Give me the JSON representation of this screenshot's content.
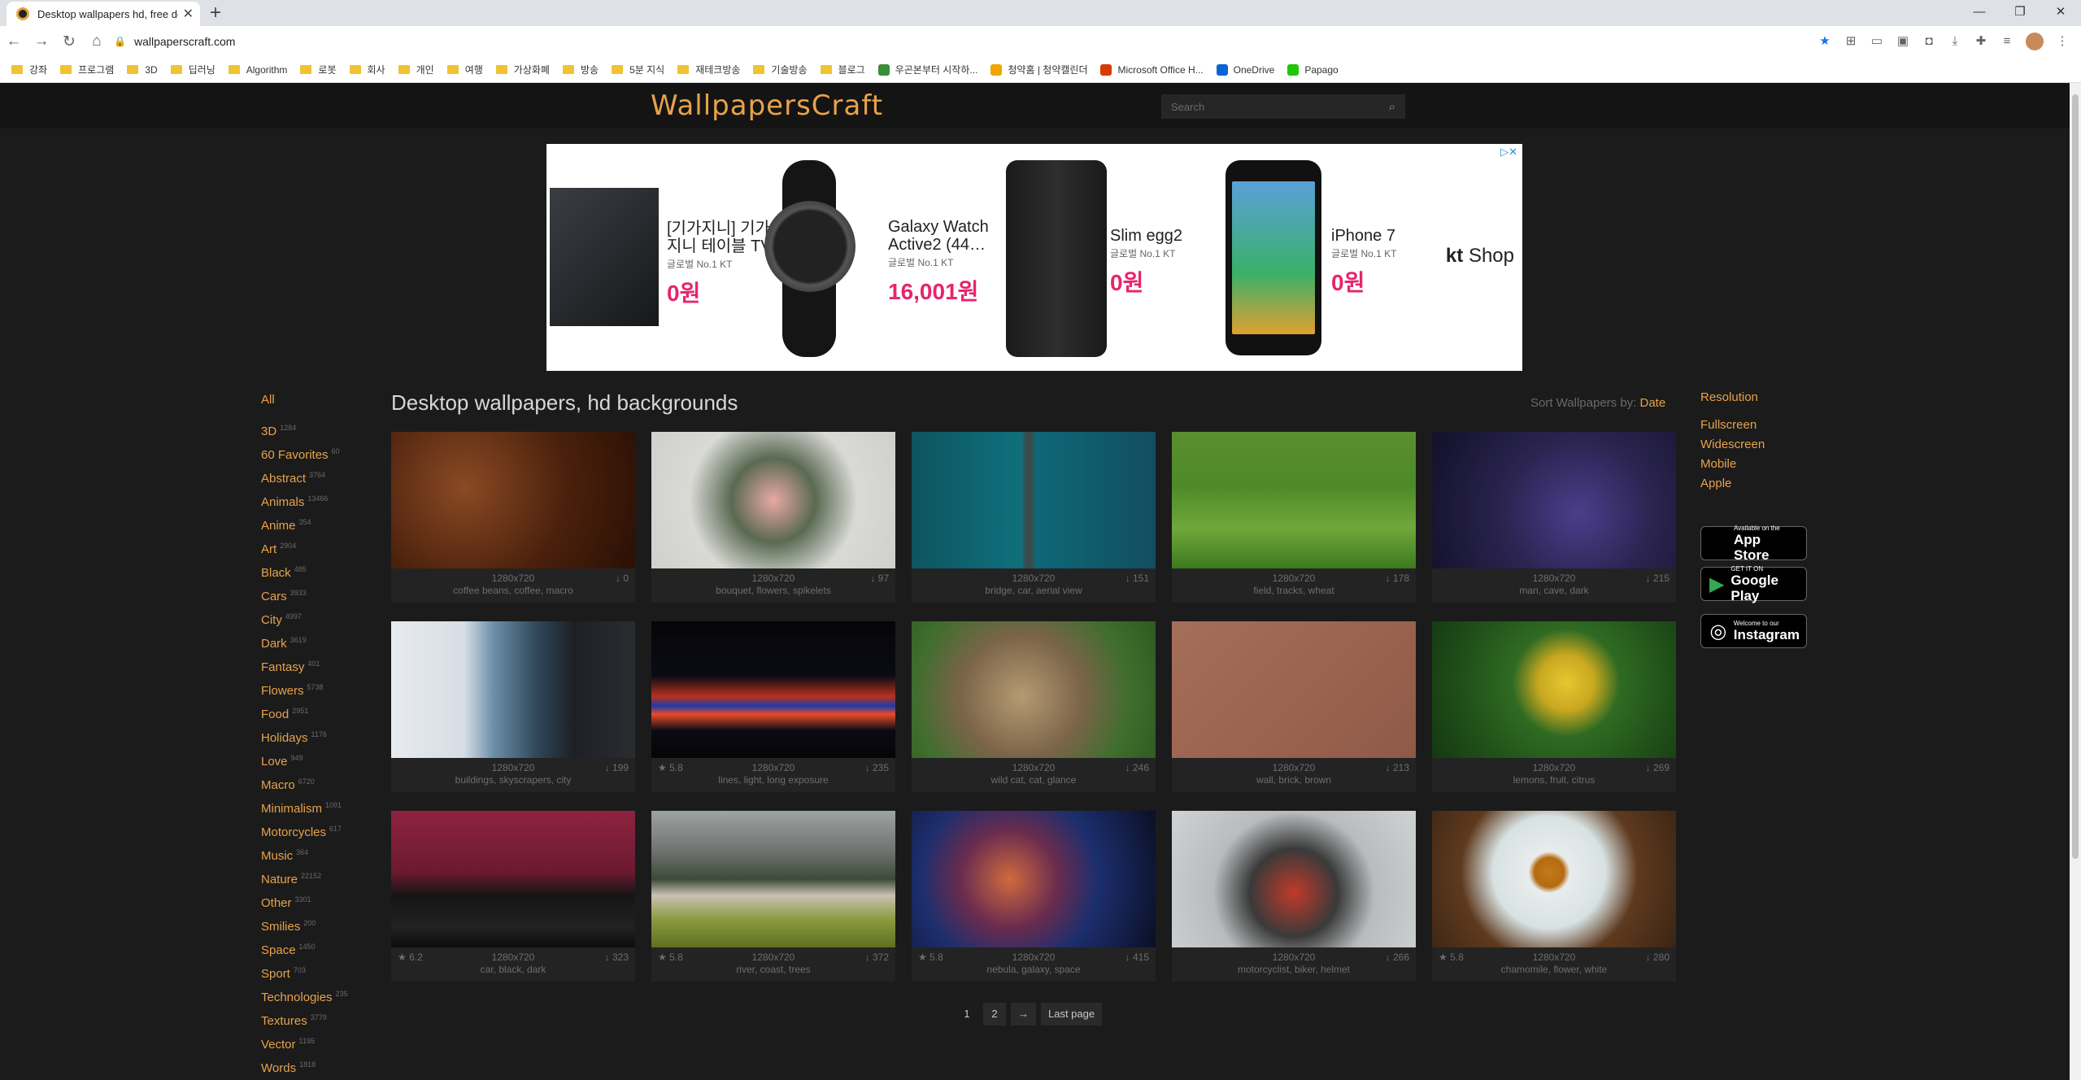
{
  "browser": {
    "tab_title": "Desktop wallpapers hd, free de...",
    "url": "wallpaperscraft.com",
    "window_controls": [
      "—",
      "❐",
      "✕"
    ],
    "bookmarks": [
      {
        "label": "강좌",
        "kind": "folder"
      },
      {
        "label": "프로그램",
        "kind": "folder"
      },
      {
        "label": "3D",
        "kind": "folder"
      },
      {
        "label": "딥러닝",
        "kind": "folder"
      },
      {
        "label": "Algorithm",
        "kind": "folder"
      },
      {
        "label": "로봇",
        "kind": "folder"
      },
      {
        "label": "회사",
        "kind": "folder"
      },
      {
        "label": "개인",
        "kind": "folder"
      },
      {
        "label": "여행",
        "kind": "folder"
      },
      {
        "label": "가상화폐",
        "kind": "folder"
      },
      {
        "label": "방송",
        "kind": "folder"
      },
      {
        "label": "5분 지식",
        "kind": "folder"
      },
      {
        "label": "재테크방송",
        "kind": "folder"
      },
      {
        "label": "기술방송",
        "kind": "folder"
      },
      {
        "label": "블로그",
        "kind": "folder"
      },
      {
        "label": "우곤본부터 시작하...",
        "kind": "site",
        "color": "#3a8d3a"
      },
      {
        "label": "청약홈 | 청약캘린더",
        "kind": "site",
        "color": "#f0a500"
      },
      {
        "label": "Microsoft Office H...",
        "kind": "site",
        "color": "#d83b01"
      },
      {
        "label": "OneDrive",
        "kind": "site",
        "color": "#0a64d6"
      },
      {
        "label": "Papago",
        "kind": "site",
        "color": "#1ec800"
      }
    ]
  },
  "site": {
    "logo": "WallpapersCraft",
    "search_placeholder": "Search",
    "page_title": "Desktop wallpapers, hd backgrounds",
    "sort_label": "Sort Wallpapers by:",
    "sort_value": "Date"
  },
  "ad": {
    "close": "▷✕",
    "items": [
      {
        "title": "[기가지니] 기가 지니 테이블 TV",
        "sub": "글로벌 No.1 KT",
        "price": "0원"
      },
      {
        "title": "Galaxy Watch Active2 (44…",
        "sub": "글로벌 No.1 KT",
        "price": "16,001원"
      },
      {
        "title": "Slim egg2",
        "sub": "글로벌 No.1 KT",
        "price": "0원"
      },
      {
        "title": "iPhone 7",
        "sub": "글로벌 No.1 KT",
        "price": "0원"
      }
    ],
    "brand_kt": "kt",
    "brand_shop": "Shop"
  },
  "categories": [
    {
      "name": "All",
      "count": ""
    },
    {
      "name": "3D",
      "count": "1284"
    },
    {
      "name": "60 Favorites",
      "count": "60"
    },
    {
      "name": "Abstract",
      "count": "3764"
    },
    {
      "name": "Animals",
      "count": "13466"
    },
    {
      "name": "Anime",
      "count": "354"
    },
    {
      "name": "Art",
      "count": "2904"
    },
    {
      "name": "Black",
      "count": "485"
    },
    {
      "name": "Cars",
      "count": "3933"
    },
    {
      "name": "City",
      "count": "4997"
    },
    {
      "name": "Dark",
      "count": "3619"
    },
    {
      "name": "Fantasy",
      "count": "401"
    },
    {
      "name": "Flowers",
      "count": "5738"
    },
    {
      "name": "Food",
      "count": "2951"
    },
    {
      "name": "Holidays",
      "count": "1176"
    },
    {
      "name": "Love",
      "count": "949"
    },
    {
      "name": "Macro",
      "count": "6720"
    },
    {
      "name": "Minimalism",
      "count": "1091"
    },
    {
      "name": "Motorcycles",
      "count": "617"
    },
    {
      "name": "Music",
      "count": "364"
    },
    {
      "name": "Nature",
      "count": "22152"
    },
    {
      "name": "Other",
      "count": "3301"
    },
    {
      "name": "Smilies",
      "count": "200"
    },
    {
      "name": "Space",
      "count": "1450"
    },
    {
      "name": "Sport",
      "count": "703"
    },
    {
      "name": "Technologies",
      "count": "235"
    },
    {
      "name": "Textures",
      "count": "3779"
    },
    {
      "name": "Vector",
      "count": "1195"
    },
    {
      "name": "Words",
      "count": "1818"
    }
  ],
  "wallpapers": [
    {
      "res": "1280x720",
      "rating": "",
      "downloads": "↓ 0",
      "tags": "coffee beans, coffee, macro",
      "bg": "radial-gradient(circle at 30% 40%, #8a4a24 0%, #4a200c 55%, #2a1005 100%)"
    },
    {
      "res": "1280x720",
      "rating": "",
      "downloads": "↓ 97",
      "tags": "bouquet, flowers, spikelets",
      "bg": "radial-gradient(circle at 50% 50%, #e8a9a4 0%, #5a6a52 30%, #d9d9d6 60%, #cfcfcc 100%)"
    },
    {
      "res": "1280x720",
      "rating": "",
      "downloads": "↓ 151",
      "tags": "bridge, car, aerial view",
      "bg": "linear-gradient(90deg, #0d5560 0%, #0f6f7c 45%, #3b4a4c 47%, #3b4a4c 49%, #0e6776 51%, #124e60 100%)"
    },
    {
      "res": "1280x720",
      "rating": "",
      "downloads": "↓ 178",
      "tags": "field, tracks, wheat",
      "bg": "linear-gradient(180deg, #5a8e2e 0%, #4e8a28 40%, #6fa83a 70%, #3d7a1e 100%)"
    },
    {
      "res": "1280x720",
      "rating": "",
      "downloads": "↓ 215",
      "tags": "man, cave, dark",
      "bg": "radial-gradient(circle at 60% 60%, #4b3e8c 0%, #2a244f 45%, #121028 100%)"
    },
    {
      "res": "1280x720",
      "rating": "",
      "downloads": "↓ 199",
      "tags": "buildings, skyscrapers, city",
      "bg": "linear-gradient(90deg, #e8ebee 0%, #d6dde4 30%, #6d8ea8 42%, #2e4658 60%, #1d2024 75%, #2a2c30 100%)"
    },
    {
      "res": "1280x720",
      "rating": "★ 5.8",
      "downloads": "↓ 235",
      "tags": "lines, light, long exposure",
      "bg": "linear-gradient(180deg, #050508 0%, #0b0b14 40%, #b8321e 55%, #1f3aa8 62%, #e84a2a 68%, #0a0a12 80%, #050508 100%)"
    },
    {
      "res": "1280x720",
      "rating": "",
      "downloads": "↓ 246",
      "tags": "wild cat, cat, glance",
      "bg": "radial-gradient(circle at 45% 55%, #b69a72 0%, #7a6448 40%, #3f6e2e 70%, #2c5a20 100%)"
    },
    {
      "res": "1280x720",
      "rating": "",
      "downloads": "↓ 213",
      "tags": "wall, brick, brown",
      "bg": "linear-gradient(135deg, #a56e5a 0%, #9c6450 50%, #8e5a48 100%)"
    },
    {
      "res": "1280x720",
      "rating": "",
      "downloads": "↓ 269",
      "tags": "lemons, fruit, citrus",
      "bg": "radial-gradient(circle at 55% 45%, #e5c830 0%, #c9a820 18%, #2f6a22 35%, #1f4e18 70%, #143812 100%)"
    },
    {
      "res": "1280x720",
      "rating": "★ 6.2",
      "downloads": "↓ 323",
      "tags": "car, black, dark",
      "bg": "linear-gradient(180deg, #8e2340 0%, #6b1a30 45%, #151515 62%, #222 85%, #0c0c0c 100%)"
    },
    {
      "res": "1280x720",
      "rating": "★ 5.8",
      "downloads": "↓ 372",
      "tags": "river, coast, trees",
      "bg": "linear-gradient(180deg, #9ea3a4 0%, #6e726e 30%, #3c4a38 50%, #c9c2b2 62%, #8a9a3e 80%, #5f6e22 100%)"
    },
    {
      "res": "1280x720",
      "rating": "★ 5.8",
      "downloads": "↓ 415",
      "tags": "nebula, galaxy, space",
      "bg": "radial-gradient(circle at 40% 50%, #d06a3e 0%, #6a2c4e 30%, #1c2e6e 55%, #0b0f24 100%)"
    },
    {
      "res": "1280x720",
      "rating": "",
      "downloads": "↓ 266",
      "tags": "motorcyclist, biker, helmet",
      "bg": "radial-gradient(circle at 50% 60%, #c03a2a 0%, #3a3a3a 30%, #b8bcbe 55%, #d0d3d4 100%)"
    },
    {
      "res": "1280x720",
      "rating": "★ 5.8",
      "downloads": "↓ 280",
      "tags": "chamomile, flower, white",
      "bg": "radial-gradient(circle at 48% 45%, #c27a1a 0%, #b56a10 10%, #e8ecec 14%, #d8e2e2 38%, #5e3a1e 60%, #3a2414 100%)"
    }
  ],
  "right_col": {
    "heading": "Resolution",
    "links": [
      "Fullscreen",
      "Widescreen",
      "Mobile",
      "Apple"
    ],
    "app_store_small": "Available on the",
    "app_store_big": "App Store",
    "google_play_small": "GET IT ON",
    "google_play_big": "Google Play",
    "instagram_small": "Welcome to our",
    "instagram_big": "Instagram"
  },
  "pagination": {
    "pages": [
      "1",
      "2"
    ],
    "next": "→",
    "last": "Last page"
  }
}
